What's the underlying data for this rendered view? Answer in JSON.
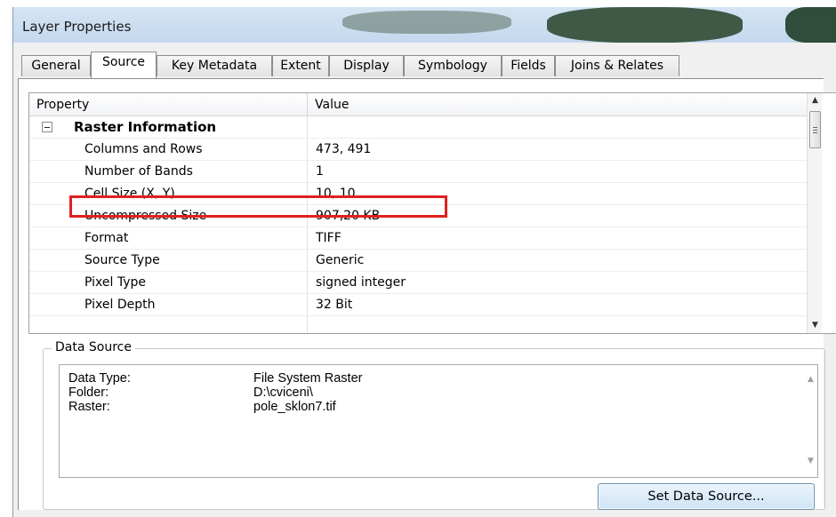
{
  "window": {
    "title": "Layer Properties"
  },
  "tabs": [
    {
      "label": "General"
    },
    {
      "label": "Source"
    },
    {
      "label": "Key Metadata"
    },
    {
      "label": "Extent"
    },
    {
      "label": "Display"
    },
    {
      "label": "Symbology"
    },
    {
      "label": "Fields"
    },
    {
      "label": "Joins & Relates"
    }
  ],
  "active_tab": "Source",
  "properties": {
    "headers": {
      "property": "Property",
      "value": "Value"
    },
    "group": "Raster Information",
    "rows": [
      {
        "property": "Columns and Rows",
        "value": "473, 491"
      },
      {
        "property": "Number of Bands",
        "value": "1"
      },
      {
        "property": "Cell Size (X, Y)",
        "value": "10, 10"
      },
      {
        "property": "Uncompressed Size",
        "value": "907,20 KB"
      },
      {
        "property": "Format",
        "value": "TIFF"
      },
      {
        "property": "Source Type",
        "value": "Generic"
      },
      {
        "property": "Pixel Type",
        "value": "signed integer"
      },
      {
        "property": "Pixel Depth",
        "value": "32 Bit"
      }
    ]
  },
  "data_source": {
    "legend": "Data Source",
    "lines": [
      {
        "label": "Data Type:",
        "value": "File System Raster"
      },
      {
        "label": "Folder:",
        "value": "D:\\cviceni\\"
      },
      {
        "label": "Raster:",
        "value": "pole_sklon7.tif"
      }
    ],
    "button_label": "Set Data Source..."
  },
  "colors": {
    "highlight": "#e02020",
    "titlebar": "#c4d8ee",
    "button": "#cfe4f6"
  }
}
